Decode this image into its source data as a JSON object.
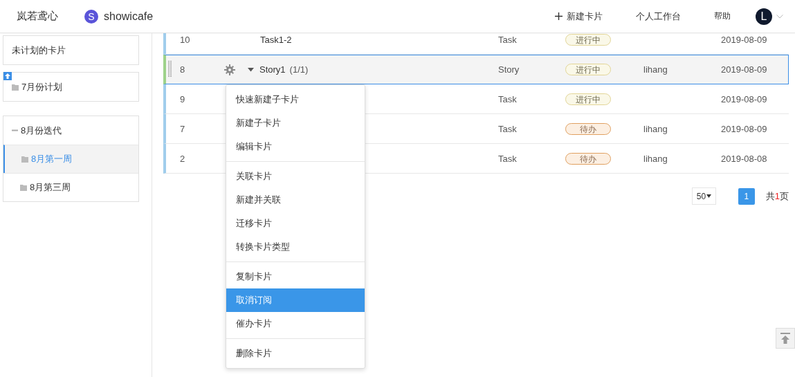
{
  "header": {
    "workspace": "岚若鸢心",
    "project": {
      "initial": "S",
      "name": "showicafe"
    },
    "actions": [
      {
        "kind": "create",
        "label": "新建卡片"
      },
      {
        "kind": "link",
        "label": "个人工作台"
      },
      {
        "kind": "link",
        "label": "帮助"
      }
    ],
    "user": {
      "initial": "L"
    }
  },
  "sidebar": {
    "items": [
      {
        "kind": "plain",
        "label": "未计划的卡片",
        "selected": false
      },
      {
        "kind": "plan",
        "label": "7月份计划",
        "selected": false,
        "pinned": true
      },
      {
        "kind": "group",
        "label": "8月份迭代",
        "expanded": true,
        "children": [
          {
            "label": "8月第一周",
            "selected": true
          },
          {
            "label": "8月第三周",
            "selected": false
          }
        ]
      }
    ]
  },
  "table": {
    "rows": [
      {
        "id": "10",
        "title": "Task1-2",
        "type": "Task",
        "status": {
          "kind": "in_progress",
          "label": "进行中"
        },
        "assignee": "",
        "date": "2019-08-09",
        "selected": false
      },
      {
        "id": "8",
        "title": "Story1",
        "count": "(1/1)",
        "expanded": true,
        "type": "Story",
        "status": {
          "kind": "in_progress",
          "label": "进行中"
        },
        "assignee": "lihang",
        "date": "2019-08-09",
        "selected": true
      },
      {
        "id": "9",
        "type": "Task",
        "status": {
          "kind": "in_progress",
          "label": "进行中"
        },
        "date": "2019-08-09",
        "selected": false
      },
      {
        "id": "7",
        "type": "Task",
        "status": {
          "kind": "todo",
          "label": "待办"
        },
        "assignee": "lihang",
        "date": "2019-08-09",
        "selected": false
      },
      {
        "id": "2",
        "type": "Task",
        "status": {
          "kind": "todo",
          "label": "待办"
        },
        "assignee": "lihang",
        "date": "2019-08-08",
        "selected": false
      }
    ]
  },
  "context_menu": {
    "groups": [
      [
        {
          "label": "快速新建子卡片",
          "selected": false
        },
        {
          "label": "新建子卡片",
          "selected": false
        },
        {
          "label": "编辑卡片",
          "selected": false
        }
      ],
      [
        {
          "label": "关联卡片",
          "selected": false
        },
        {
          "label": "新建并关联",
          "selected": false
        },
        {
          "label": "迁移卡片",
          "selected": false
        },
        {
          "label": "转换卡片类型",
          "selected": false
        }
      ],
      [
        {
          "label": "复制卡片",
          "selected": false
        },
        {
          "label": "取消订阅",
          "selected": true
        },
        {
          "label": "催办卡片",
          "selected": false
        }
      ],
      [
        {
          "label": "删除卡片",
          "selected": false
        }
      ]
    ]
  },
  "pagination": {
    "page_size": "50",
    "pages": [
      {
        "label": "1",
        "selected": true
      }
    ],
    "total": {
      "before": "共",
      "count": "1",
      "after": "页"
    }
  }
}
